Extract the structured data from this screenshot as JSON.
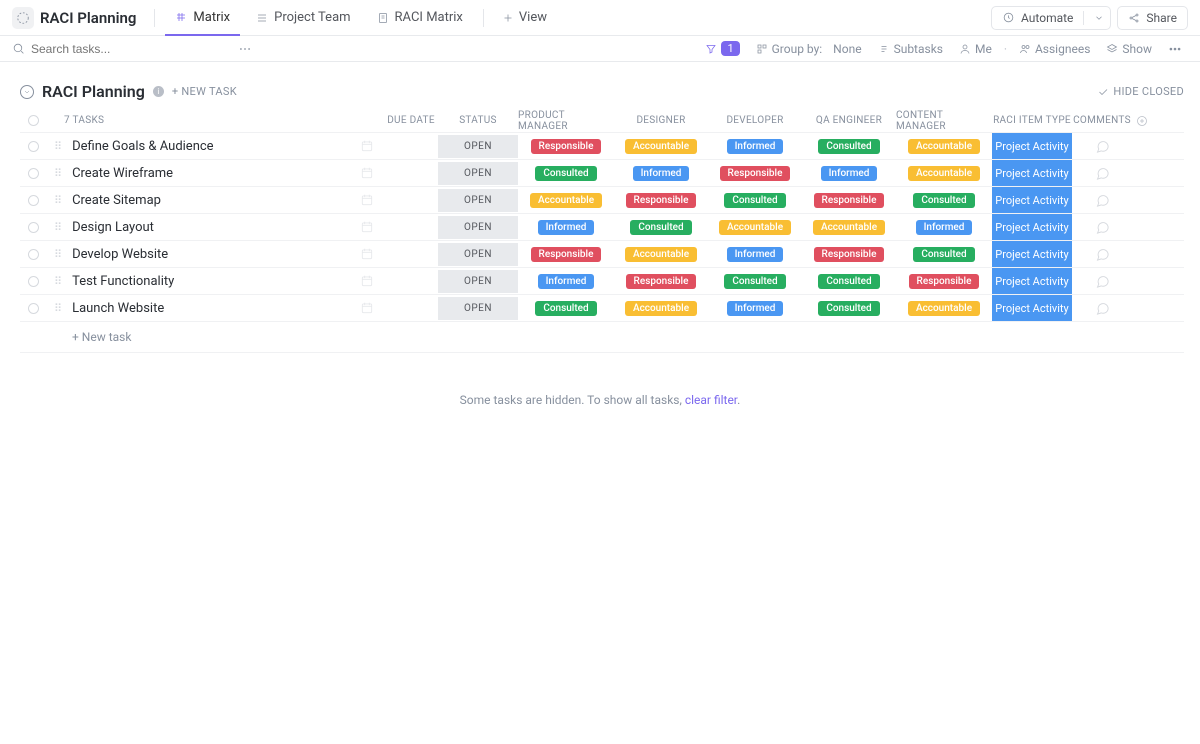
{
  "header": {
    "board_title": "RACI Planning",
    "tabs": [
      {
        "label": "Matrix",
        "active": true
      },
      {
        "label": "Project Team",
        "active": false
      },
      {
        "label": "RACI Matrix",
        "active": false
      }
    ],
    "view_btn": "View",
    "automate": "Automate",
    "share": "Share"
  },
  "filterbar": {
    "search_placeholder": "Search tasks...",
    "filter_count": "1",
    "group_by_label": "Group by:",
    "group_by_value": "None",
    "subtasks": "Subtasks",
    "me": "Me",
    "assignees": "Assignees",
    "show": "Show"
  },
  "section": {
    "title": "RACI Planning",
    "new_task": "+ New task",
    "hide_closed": "Hide closed",
    "task_count": "7 tasks"
  },
  "columns": {
    "due_date": "Due date",
    "status": "Status",
    "product_manager": "Product Manager",
    "designer": "Designer",
    "developer": "Developer",
    "qa_engineer": "QA Engineer",
    "content_manager": "Content Manager",
    "raci_item_type": "RACI Item Type",
    "comments": "Comments"
  },
  "status_open": "OPEN",
  "type_value": "Project Activity",
  "tasks": [
    {
      "name": "Define Goals & Audience",
      "roles": [
        "responsible",
        "accountable",
        "informed",
        "consulted",
        "accountable"
      ]
    },
    {
      "name": "Create Wireframe",
      "roles": [
        "consulted",
        "informed",
        "responsible",
        "informed",
        "accountable"
      ]
    },
    {
      "name": "Create Sitemap",
      "roles": [
        "accountable",
        "responsible",
        "consulted",
        "responsible",
        "consulted"
      ]
    },
    {
      "name": "Design Layout",
      "roles": [
        "informed",
        "consulted",
        "accountable",
        "accountable",
        "informed"
      ]
    },
    {
      "name": "Develop Website",
      "roles": [
        "responsible",
        "accountable",
        "informed",
        "responsible",
        "consulted"
      ]
    },
    {
      "name": "Test Functionality",
      "roles": [
        "informed",
        "responsible",
        "consulted",
        "consulted",
        "responsible"
      ]
    },
    {
      "name": "Launch Website",
      "roles": [
        "consulted",
        "accountable",
        "informed",
        "consulted",
        "accountable"
      ]
    }
  ],
  "role_labels": {
    "responsible": "Responsible",
    "accountable": "Accountable",
    "informed": "Informed",
    "consulted": "Consulted"
  },
  "footer": {
    "new_task": "+ New task",
    "hidden_prefix": "Some tasks are hidden. To show all tasks, ",
    "clear_filter": "clear filter",
    "hidden_suffix": "."
  }
}
